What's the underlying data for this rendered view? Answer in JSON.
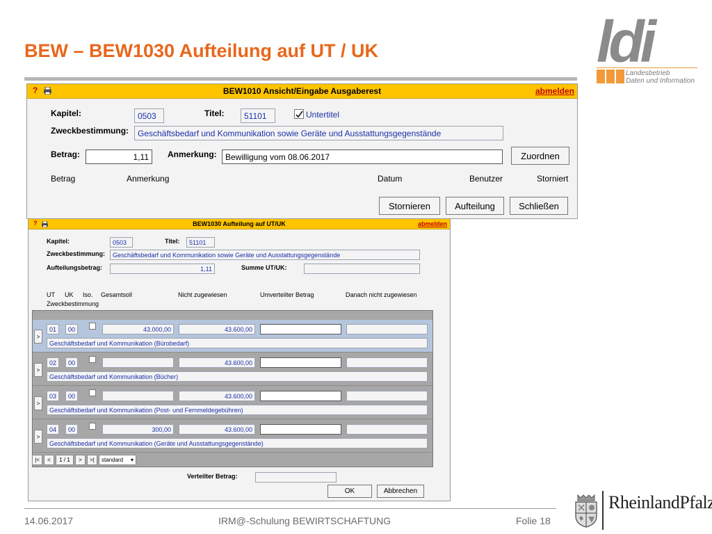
{
  "slide": {
    "title": "BEW – BEW1030 Aufteilung auf UT / UK",
    "logo": {
      "letters": "ldi",
      "line1": "Landesbetrieb",
      "line2": "Daten und Information"
    },
    "footer": {
      "date": "14.06.2017",
      "center": "IRM@-Schulung BEWIRTSCHAFTUNG",
      "slide_no": "Folie 18",
      "state_logo": "RheinlandPfalz"
    }
  },
  "w1": {
    "help": "?",
    "title": "BEW1010 Ansicht/Eingabe Ausgaberest",
    "logout": "abmelden",
    "kapitel_label": "Kapitel:",
    "kapitel": "0503",
    "titel_label": "Titel:",
    "titel": "51101",
    "untertitel_label": "Untertitel",
    "untertitel_checked": true,
    "zweck_label": "Zweckbestimmung:",
    "zweck": "Geschäftsbedarf und Kommunikation sowie Geräte und Ausstattungsgegenstände",
    "betrag_label": "Betrag:",
    "betrag": "1,11",
    "anmerkung_label": "Anmerkung:",
    "anmerkung": "Bewilligung vom 08.06.2017",
    "zuordnen": "Zuordnen",
    "columns": [
      "Betrag",
      "Anmerkung",
      "Datum",
      "Benutzer",
      "Storniert"
    ],
    "buttons": [
      "Stornieren",
      "Aufteilung",
      "Schließen"
    ]
  },
  "w2": {
    "help": "?",
    "title": "BEW1030 Aufteilung auf UT/UK",
    "logout": "abmelden",
    "kapitel_label": "Kapitel:",
    "kapitel": "0503",
    "titel_label": "Titel:",
    "titel": "51101",
    "zweck_label": "Zweckbestimmung:",
    "zweck": "Geschäftsbedarf und Kommunikation sowie Geräte und Ausstattungsgegenstände",
    "aufteilungsbetrag_label": "Aufteilungsbetrag:",
    "aufteilungsbetrag": "1,11",
    "summe_label": "Summe UT/UK:",
    "summe": "",
    "headers": {
      "ut": "UT",
      "uk": "UK",
      "iso": "Iso.",
      "gesamtsoll": "Gesamtsoll",
      "nicht": "Nicht zugewiesen",
      "umverteilt": "Umverteilter Betrag",
      "danach": "Danach nicht zugewiesen",
      "zweck": "Zweckbestimmung"
    },
    "rows": [
      {
        "sel": ">",
        "ut": "01",
        "uk": "00",
        "gesamtsoll": "43.000,00",
        "nicht": "43.600,00",
        "umverteilt": "",
        "danach": "",
        "zweck": "Geschäftsbedarf und Kommunikation (Bürobedarf)"
      },
      {
        "sel": ">",
        "ut": "02",
        "uk": "00",
        "gesamtsoll": "",
        "nicht": "43.600,00",
        "umverteilt": "",
        "danach": "",
        "zweck": "Geschäftsbedarf und Kommunikation (Bücher)"
      },
      {
        "sel": ">",
        "ut": "03",
        "uk": "00",
        "gesamtsoll": "",
        "nicht": "43.600,00",
        "umverteilt": "",
        "danach": "",
        "zweck": "Geschäftsbedarf und Kommunikation (Post- und Fernmeldegebühren)"
      },
      {
        "sel": ">",
        "ut": "04",
        "uk": "00",
        "gesamtsoll": "300,00",
        "nicht": "43.600,00",
        "umverteilt": "",
        "danach": "",
        "zweck": "Geschäftsbedarf und Kommunikation (Geräte und Ausstattungsgegenstände)"
      }
    ],
    "nav": {
      "first": "|<",
      "prev": "<",
      "page": "1 / 1",
      "next": ">",
      "last": ">|",
      "view": "standard"
    },
    "verteilt_label": "Verteilter Betrag:",
    "verteilt": "",
    "ok": "OK",
    "abbrechen": "Abbrechen"
  }
}
